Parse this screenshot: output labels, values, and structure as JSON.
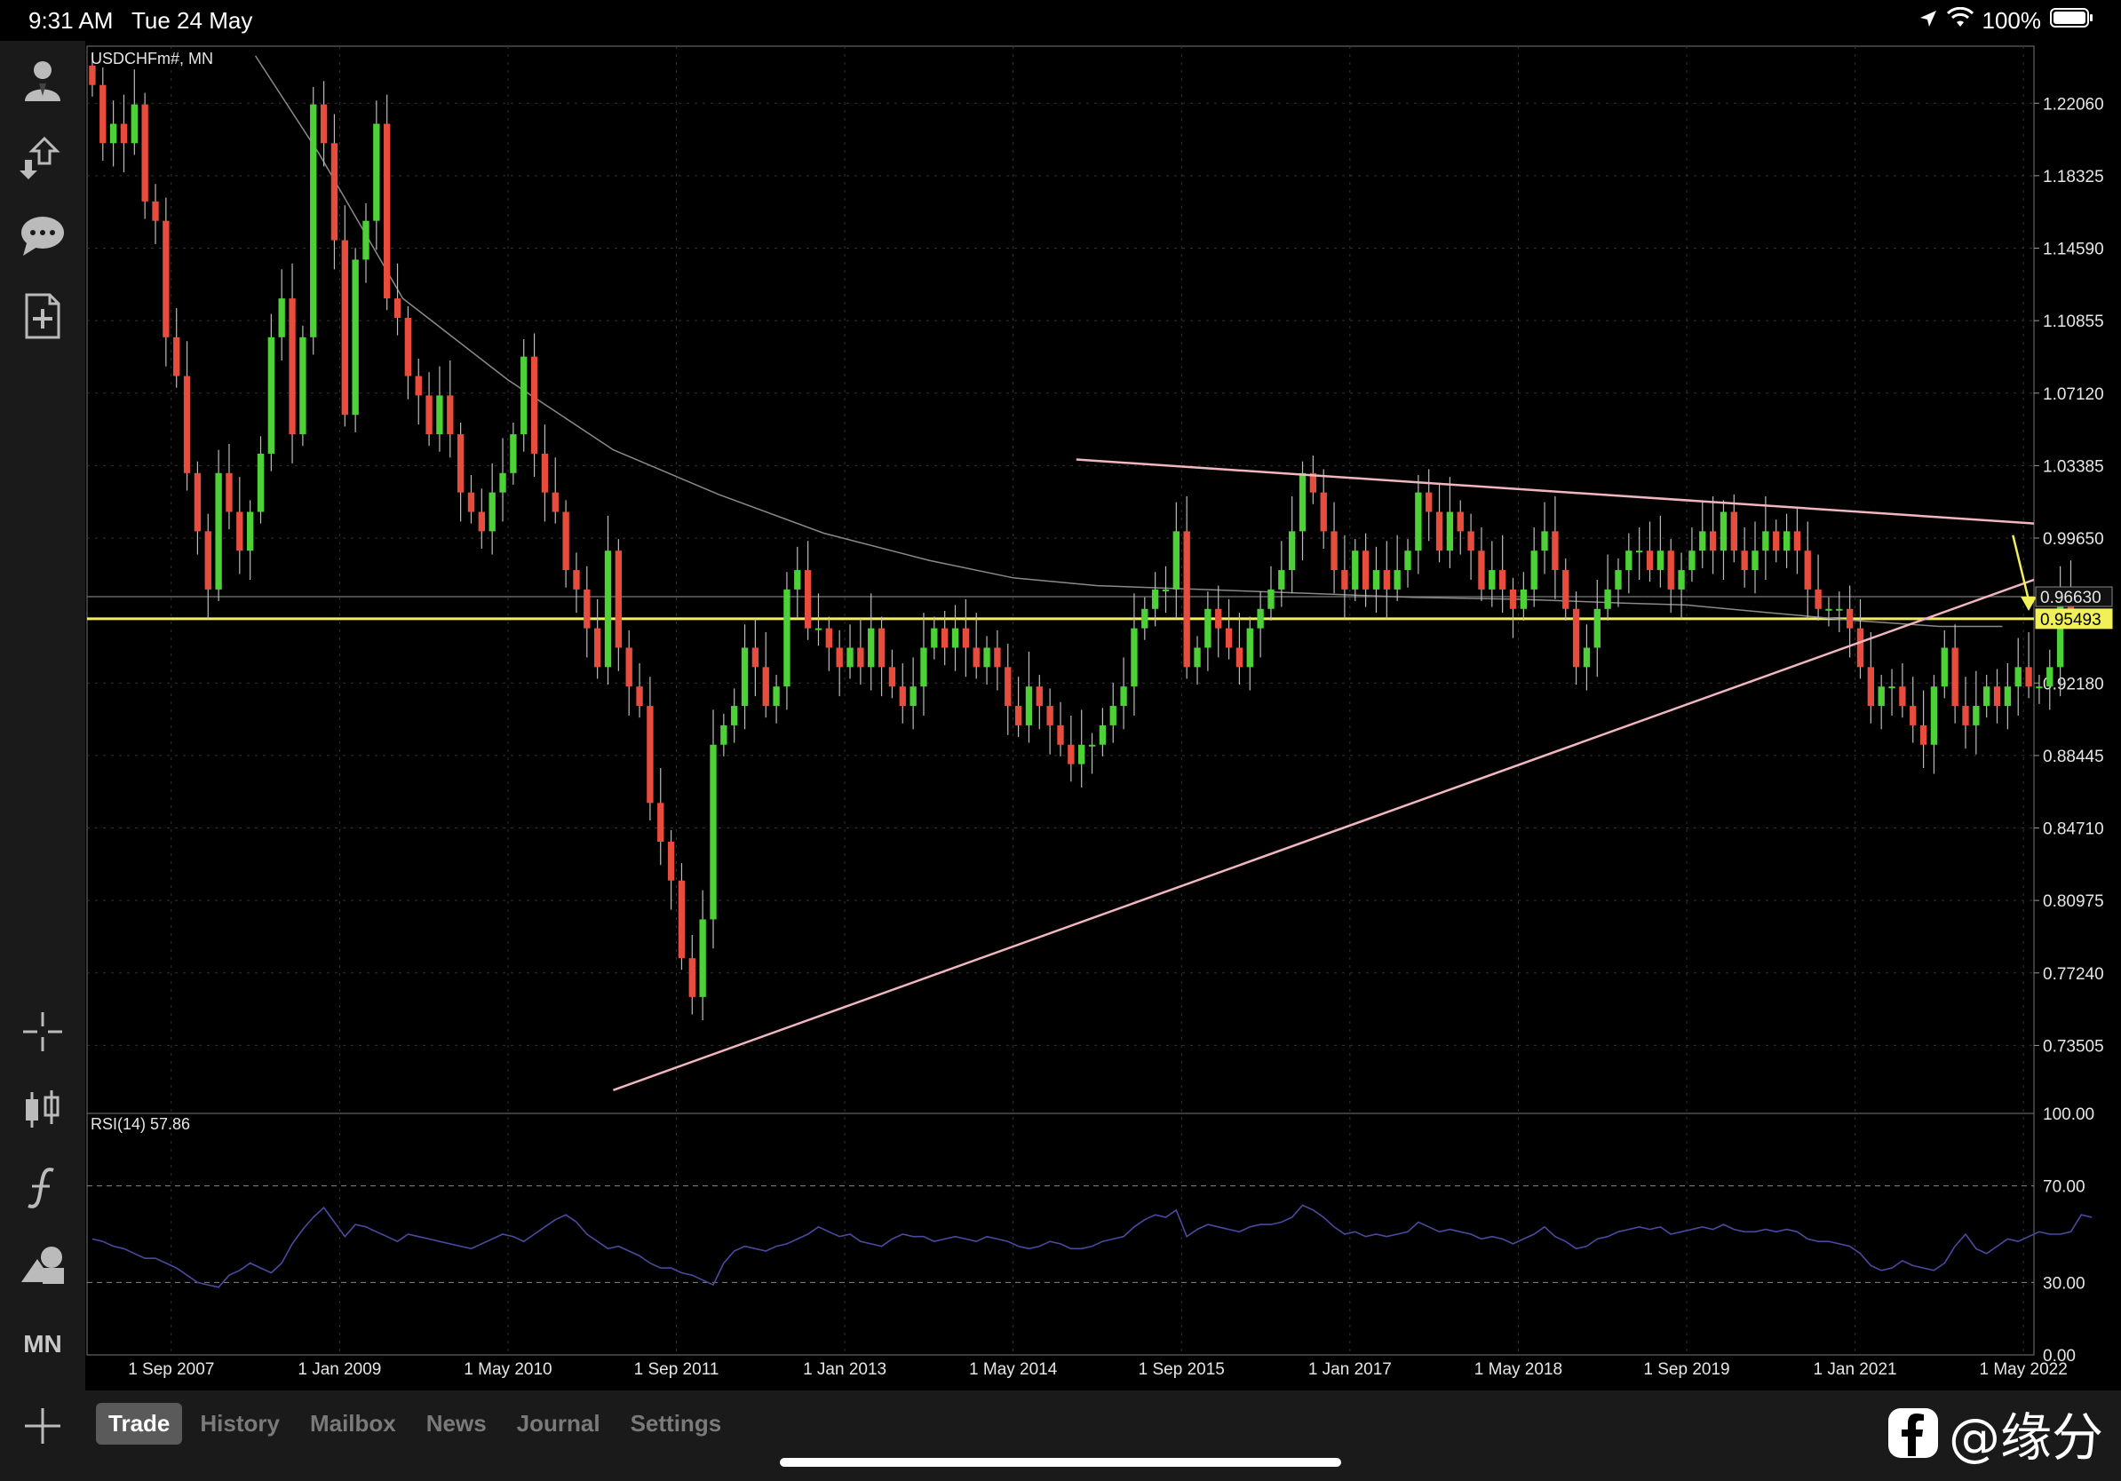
{
  "status_bar": {
    "time": "9:31 AM",
    "date": "Tue 24 May",
    "battery": "100%"
  },
  "sidebar": {
    "items": [
      {
        "icon": "account-icon"
      },
      {
        "icon": "deposit-withdraw-icon"
      },
      {
        "icon": "chat-icon"
      },
      {
        "icon": "new-order-icon"
      },
      {
        "icon": "crosshair-icon"
      },
      {
        "icon": "chart-type-icon"
      },
      {
        "icon": "indicators-icon"
      },
      {
        "icon": "objects-icon"
      },
      {
        "label": "MN"
      }
    ]
  },
  "tabs": [
    {
      "label": "Trade",
      "active": true
    },
    {
      "label": "History",
      "active": false
    },
    {
      "label": "Mailbox",
      "active": false
    },
    {
      "label": "News",
      "active": false
    },
    {
      "label": "Journal",
      "active": false
    },
    {
      "label": "Settings",
      "active": false
    }
  ],
  "watermark": {
    "text": "@缘分"
  },
  "chart_data": {
    "type": "candlestick",
    "symbol_label": "USDCHFm#, MN",
    "colors": {
      "up": "#4cd137",
      "down": "#e74c3c",
      "ma": "#8a8a8a",
      "rsi": "#4a4aa0",
      "trendline": "#f2b6c0",
      "hline": "#f0f05a",
      "arrow": "#f0f05a"
    },
    "ylim": [
      0.7,
      1.25
    ],
    "y_ticks": [
      "1.22060",
      "1.18325",
      "1.14590",
      "1.10855",
      "1.07120",
      "1.03385",
      "0.99650",
      "0.92180",
      "0.88445",
      "0.84710",
      "0.80975",
      "0.77240",
      "0.73505"
    ],
    "price_labels": [
      {
        "text": "0.96630",
        "value": 0.9663,
        "style": "gray"
      },
      {
        "text": "0.95493",
        "value": 0.95493,
        "style": "yellow"
      }
    ],
    "x_ticks": [
      "1 Sep 2007",
      "1 Jan 2009",
      "1 May 2010",
      "1 Sep 2011",
      "1 Jan 2013",
      "1 May 2014",
      "1 Sep 2015",
      "1 Jan 2017",
      "1 May 2018",
      "1 Sep 2019",
      "1 Jan 2021",
      "1 May 2022"
    ],
    "x_tick_months": [
      8,
      24,
      40,
      56,
      72,
      88,
      104,
      120,
      136,
      152,
      168,
      184
    ],
    "x_max_months": 185,
    "closes": [
      1.23,
      1.2,
      1.21,
      1.2,
      1.22,
      1.17,
      1.16,
      1.1,
      1.08,
      1.03,
      1.0,
      0.97,
      1.03,
      1.01,
      0.99,
      1.01,
      1.04,
      1.1,
      1.12,
      1.05,
      1.1,
      1.22,
      1.2,
      1.15,
      1.06,
      1.14,
      1.16,
      1.21,
      1.12,
      1.11,
      1.08,
      1.07,
      1.05,
      1.07,
      1.05,
      1.02,
      1.01,
      1.0,
      1.02,
      1.03,
      1.05,
      1.09,
      1.04,
      1.02,
      1.01,
      0.98,
      0.97,
      0.95,
      0.93,
      0.99,
      0.94,
      0.92,
      0.91,
      0.86,
      0.84,
      0.82,
      0.78,
      0.76,
      0.8,
      0.89,
      0.9,
      0.91,
      0.94,
      0.93,
      0.91,
      0.92,
      0.97,
      0.98,
      0.95,
      0.95,
      0.94,
      0.93,
      0.94,
      0.93,
      0.95,
      0.93,
      0.92,
      0.91,
      0.92,
      0.94,
      0.95,
      0.94,
      0.95,
      0.94,
      0.93,
      0.94,
      0.93,
      0.91,
      0.9,
      0.92,
      0.91,
      0.9,
      0.89,
      0.88,
      0.89,
      0.89,
      0.9,
      0.91,
      0.92,
      0.95,
      0.96,
      0.97,
      0.97,
      1.0,
      0.93,
      0.94,
      0.96,
      0.95,
      0.94,
      0.93,
      0.95,
      0.96,
      0.97,
      0.98,
      1.0,
      1.03,
      1.02,
      1.0,
      0.98,
      0.97,
      0.99,
      0.97,
      0.98,
      0.97,
      0.98,
      0.99,
      1.02,
      1.01,
      0.99,
      1.01,
      1.0,
      0.99,
      0.97,
      0.98,
      0.97,
      0.96,
      0.97,
      0.99,
      1.0,
      0.98,
      0.96,
      0.93,
      0.94,
      0.96,
      0.97,
      0.98,
      0.99,
      0.99,
      0.98,
      0.99,
      0.97,
      0.98,
      0.99,
      1.0,
      0.99,
      1.01,
      0.99,
      0.98,
      0.99,
      1.0,
      0.99,
      1.0,
      0.99,
      0.97,
      0.96,
      0.96,
      0.96,
      0.95,
      0.93,
      0.91,
      0.92,
      0.92,
      0.91,
      0.9,
      0.89,
      0.92,
      0.94,
      0.91,
      0.9,
      0.91,
      0.92,
      0.91,
      0.92,
      0.93,
      0.92,
      0.92,
      0.93,
      0.97,
      0.96
    ],
    "ma_points": [
      [
        16,
        1.245
      ],
      [
        22,
        1.195
      ],
      [
        30,
        1.12
      ],
      [
        40,
        1.078
      ],
      [
        50,
        1.042
      ],
      [
        60,
        1.019
      ],
      [
        70,
        0.999
      ],
      [
        80,
        0.985
      ],
      [
        88,
        0.976
      ],
      [
        96,
        0.972
      ],
      [
        106,
        0.97
      ],
      [
        116,
        0.968
      ],
      [
        126,
        0.966
      ],
      [
        136,
        0.965
      ],
      [
        146,
        0.963
      ],
      [
        152,
        0.962
      ],
      [
        160,
        0.958
      ],
      [
        168,
        0.954
      ],
      [
        176,
        0.951
      ],
      [
        182,
        0.951
      ]
    ],
    "trendlines": [
      {
        "from": [
          50,
          0.712
        ],
        "to": [
          185,
          0.975
        ]
      },
      {
        "from": [
          94,
          1.037
        ],
        "to": [
          185,
          1.004
        ]
      }
    ],
    "horizontal_lines": [
      {
        "value": 0.9663,
        "style": "gray"
      },
      {
        "value": 0.95493,
        "style": "yellow"
      }
    ],
    "arrow": {
      "from": [
        183,
        0.998
      ],
      "to": [
        184.5,
        0.959
      ]
    },
    "rsi": {
      "label": "RSI(14) 57.86",
      "ylim": [
        0,
        100
      ],
      "y_ticks": [
        "100.00",
        "70.00",
        "30.00",
        "0.00"
      ],
      "levels": [
        70,
        30
      ],
      "values": [
        48,
        47,
        45,
        44,
        42,
        40,
        40,
        38,
        36,
        33,
        30,
        29,
        28,
        33,
        35,
        38,
        36,
        34,
        38,
        46,
        52,
        57,
        61,
        55,
        49,
        54,
        53,
        51,
        49,
        47,
        50,
        49,
        48,
        47,
        46,
        45,
        44,
        46,
        48,
        50,
        49,
        47,
        50,
        53,
        56,
        58,
        55,
        50,
        47,
        44,
        45,
        43,
        41,
        38,
        36,
        36,
        34,
        33,
        31,
        29,
        38,
        43,
        45,
        44,
        43,
        45,
        46,
        48,
        50,
        53,
        51,
        49,
        50,
        47,
        46,
        45,
        48,
        50,
        49,
        49,
        47,
        48,
        49,
        48,
        47,
        49,
        48,
        47,
        45,
        44,
        45,
        47,
        46,
        44,
        44,
        45,
        47,
        48,
        49,
        53,
        56,
        58,
        57,
        60,
        49,
        52,
        54,
        53,
        52,
        51,
        53,
        54,
        54,
        55,
        57,
        62,
        60,
        57,
        53,
        50,
        51,
        49,
        50,
        49,
        50,
        51,
        55,
        53,
        51,
        52,
        51,
        50,
        48,
        49,
        48,
        46,
        48,
        50,
        53,
        49,
        47,
        44,
        45,
        48,
        49,
        51,
        52,
        53,
        52,
        53,
        50,
        51,
        52,
        53,
        52,
        54,
        52,
        51,
        51,
        52,
        51,
        52,
        51,
        48,
        47,
        47,
        46,
        45,
        42,
        37,
        35,
        36,
        39,
        37,
        36,
        35,
        38,
        45,
        50,
        44,
        42,
        45,
        48,
        47,
        49,
        51,
        50,
        50,
        51,
        58,
        57
      ]
    }
  }
}
